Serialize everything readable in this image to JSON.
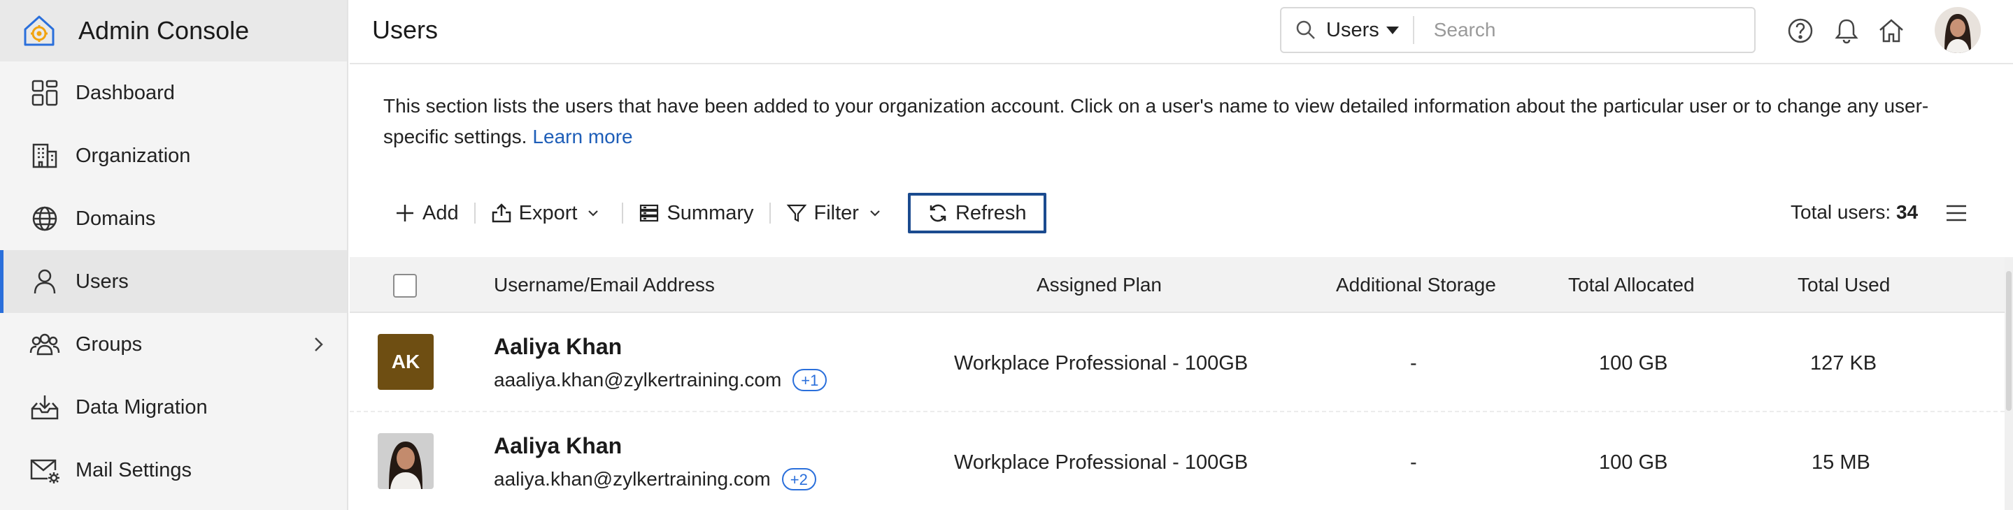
{
  "app": {
    "title": "Admin Console"
  },
  "sidebar": {
    "items": [
      {
        "label": "Dashboard",
        "icon": "dashboard-icon"
      },
      {
        "label": "Organization",
        "icon": "building-icon"
      },
      {
        "label": "Domains",
        "icon": "globe-icon"
      },
      {
        "label": "Users",
        "icon": "user-icon",
        "active": true
      },
      {
        "label": "Groups",
        "icon": "groups-icon",
        "has_submenu": true
      },
      {
        "label": "Data Migration",
        "icon": "inbox-download-icon"
      },
      {
        "label": "Mail Settings",
        "icon": "mail-gear-icon"
      }
    ]
  },
  "header": {
    "title": "Users",
    "search": {
      "scope": "Users",
      "placeholder": "Search"
    }
  },
  "main": {
    "description": "This section lists the users that have been added to your organization account. Click on a user's name to view detailed information about the particular user or to change any user-specific settings.",
    "learn_more": "Learn more",
    "toolbar": {
      "add": "Add",
      "export": "Export",
      "summary": "Summary",
      "filter": "Filter",
      "refresh": "Refresh"
    },
    "total_label": "Total users:",
    "total_count": "34",
    "table": {
      "columns": [
        "Username/Email Address",
        "Assigned Plan",
        "Additional Storage",
        "Total Allocated",
        "Total Used"
      ],
      "rows": [
        {
          "initials": "AK",
          "avatar_color": "#6e4e12",
          "name": "Aaliya Khan",
          "email": "aaaliya.khan@zylkertraining.com",
          "extra": "+1",
          "plan": "Workplace Professional - 100GB",
          "storage": "-",
          "allocated": "100 GB",
          "used": "127 KB"
        },
        {
          "initials": "",
          "avatar_color": "#d8d8d8",
          "name": "Aaliya Khan",
          "email": "aaliya.khan@zylkertraining.com",
          "extra": "+2",
          "plan": "Workplace Professional - 100GB",
          "storage": "-",
          "allocated": "100 GB",
          "used": "15 MB"
        }
      ]
    }
  },
  "colors": {
    "accent": "#2a6fdb",
    "refresh_border": "#1b4b8f",
    "logo_orange": "#f2a30f",
    "logo_blue": "#2a6fdb"
  }
}
